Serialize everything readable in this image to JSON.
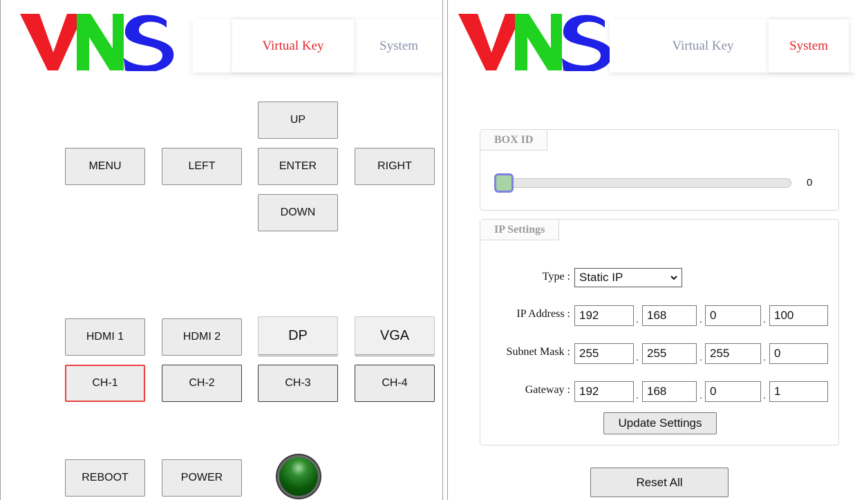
{
  "brand": {
    "letters": [
      "V",
      "N",
      "S"
    ],
    "colors": {
      "V": "#ee1c24",
      "N": "#1fd21f",
      "S": "#1f22e6"
    }
  },
  "left": {
    "nav": {
      "virtual_key": "Virtual Key",
      "system": "System",
      "active": "Virtual Key"
    },
    "keys": {
      "up": "UP",
      "menu": "MENU",
      "left": "LEFT",
      "enter": "ENTER",
      "right": "RIGHT",
      "down": "DOWN"
    },
    "inputs": {
      "hdmi1": "HDMI 1",
      "hdmi2": "HDMI 2",
      "dp": "DP",
      "vga": "VGA"
    },
    "channels": {
      "ch1": "CH-1",
      "ch2": "CH-2",
      "ch3": "CH-3",
      "ch4": "CH-4",
      "selected": "CH-1"
    },
    "bottom": {
      "reboot": "REBOOT",
      "power": "POWER"
    },
    "status_led": "power-led-icon"
  },
  "right": {
    "nav": {
      "virtual_key": "Virtual Key",
      "system": "System",
      "active": "System"
    },
    "box_id": {
      "legend": "BOX ID",
      "value": "0",
      "slider_fraction": 0
    },
    "ip_settings": {
      "legend": "IP Settings",
      "type_label": "Type :",
      "type_value": "Static IP",
      "ip_label": "IP Address :",
      "ip": [
        "192",
        "168",
        "0",
        "100"
      ],
      "mask_label": "Subnet Mask :",
      "mask": [
        "255",
        "255",
        "255",
        "0"
      ],
      "gw_label": "Gateway :",
      "gw": [
        "192",
        "168",
        "0",
        "1"
      ],
      "update_button": "Update Settings"
    },
    "reset_button": "Reset All"
  }
}
